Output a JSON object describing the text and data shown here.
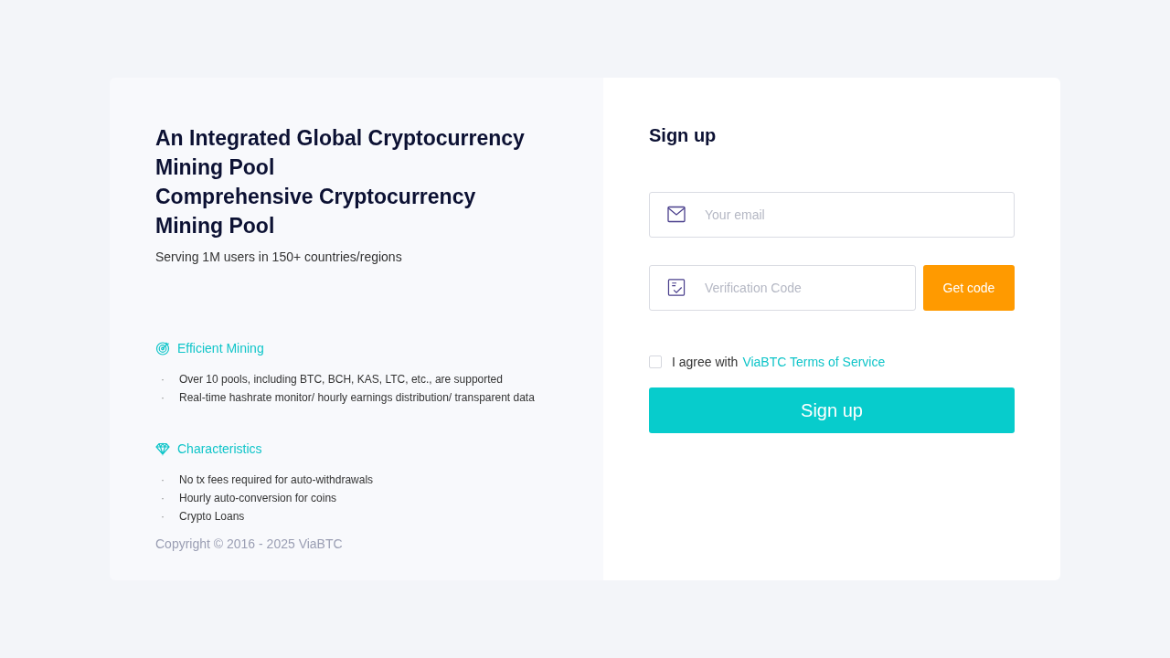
{
  "intro": {
    "headlines": [
      "An Integrated Global Cryptocurrency Mining Pool",
      "Comprehensive Cryptocurrency Mining Pool"
    ],
    "subtitle": "Serving 1M users in 150+ countries/regions"
  },
  "features": [
    {
      "kind": "target",
      "title": "Efficient Mining",
      "items": [
        {
          "marker": "·",
          "text": "Over 10 pools, including BTC, BCH, KAS, LTC, etc., are supported"
        },
        {
          "marker": "·",
          "text": "Real-time hashrate monitor/ hourly earnings distribution/ transparent data"
        }
      ]
    },
    {
      "kind": "diamond",
      "title": "Characteristics",
      "items": [
        {
          "marker": "·",
          "text": "No tx fees required for auto-withdrawals"
        },
        {
          "marker": "·",
          "text": "Hourly auto-conversion for coins"
        },
        {
          "marker": "·",
          "text": "Crypto Loans"
        }
      ]
    }
  ],
  "copyright": "Copyright © 2016 - 2025 ViaBTC",
  "form": {
    "title": "Sign up",
    "email": {
      "placeholder": "Your email"
    },
    "code": {
      "placeholder": "Verification Code",
      "button": "Get code"
    },
    "agree": {
      "checked": false,
      "text": "I agree with",
      "link": "ViaBTC Terms of Service"
    },
    "submit": "Sign up"
  }
}
